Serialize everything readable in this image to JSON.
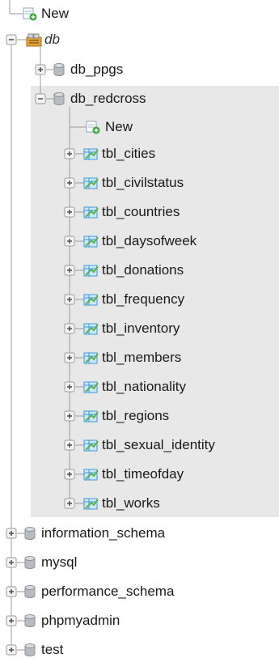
{
  "tree": {
    "root_new": "New",
    "root_group": "db",
    "databases": [
      {
        "name": "db_ppgs",
        "expanded": false
      },
      {
        "name": "db_redcross",
        "expanded": true
      }
    ],
    "redcross_new": "New",
    "tables": [
      "tbl_cities",
      "tbl_civilstatus",
      "tbl_countries",
      "tbl_daysofweek",
      "tbl_donations",
      "tbl_frequency",
      "tbl_inventory",
      "tbl_members",
      "tbl_nationality",
      "tbl_regions",
      "tbl_sexual_identity",
      "tbl_timeofday",
      "tbl_works"
    ],
    "other_databases": [
      "information_schema",
      "mysql",
      "performance_schema",
      "phpmyadmin",
      "test"
    ]
  },
  "colors": {
    "tree_line": "#9a9a9a",
    "highlight": "#e8e8e8",
    "expander_border": "#9a9a9a",
    "new_badge": "#3aa43a",
    "db_icon": "#b8bcc0",
    "table_icon": "#3a9bd9",
    "table_arrow": "#55b055"
  },
  "icons": {
    "new": "new-item-icon",
    "group": "database-group-icon",
    "database": "database-cylinder-icon",
    "table": "table-icon",
    "expand": "plus-expander-icon",
    "collapse": "minus-expander-icon"
  }
}
